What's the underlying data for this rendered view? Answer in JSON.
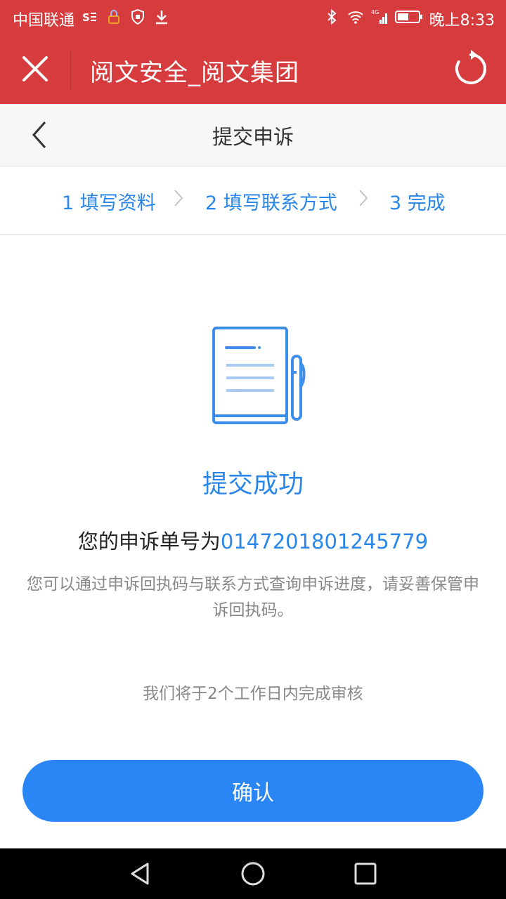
{
  "status_bar": {
    "carrier": "中国联通",
    "time": "晚上8:33",
    "network": "4G"
  },
  "title_bar": {
    "title": "阅文安全_阅文集团"
  },
  "page_header": {
    "title": "提交申诉"
  },
  "steps": [
    {
      "label": "1 填写资料"
    },
    {
      "label": "2 填写联系方式"
    },
    {
      "label": "3 完成"
    }
  ],
  "result": {
    "title": "提交成功",
    "case_prefix": "您的申诉单号为",
    "case_number": "0147201801245779",
    "info": "您可以通过申诉回执码与联系方式查询申诉进度，请妥善保管申诉回执码。",
    "review_note": "我们将于2个工作日内完成审核"
  },
  "actions": {
    "confirm_label": "确认"
  },
  "colors": {
    "brand_red": "#d63b3d",
    "accent_blue": "#2a86e8",
    "button_blue": "#2b86f5"
  }
}
